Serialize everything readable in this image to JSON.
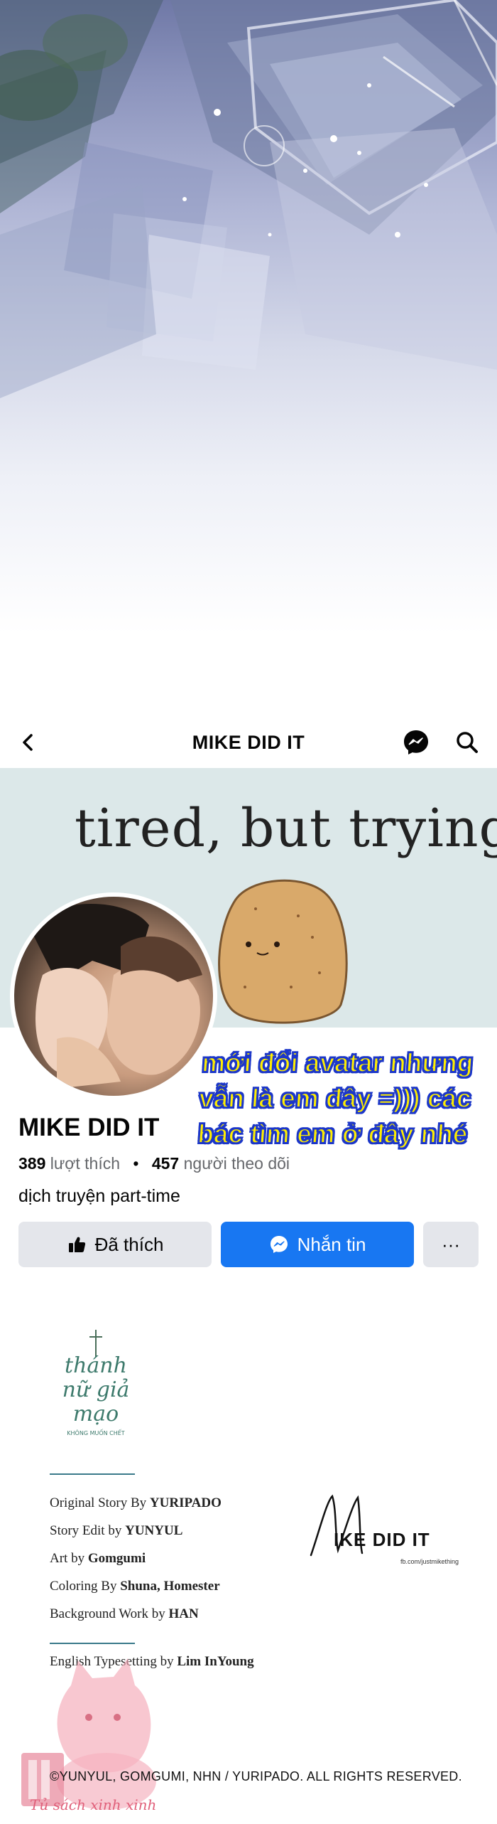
{
  "header": {
    "title": "MIKE DID IT",
    "back_icon": "chevron-left-icon",
    "messenger_icon": "messenger-icon",
    "search_icon": "search-icon"
  },
  "cover": {
    "text": "tired, but trying"
  },
  "caption": {
    "lines": [
      "mới đổi avatar nhưng",
      "vẫn là em đây =))) các",
      "bác tìm em ở đây nhé"
    ]
  },
  "page": {
    "name": "MIKE DID IT",
    "likes_count": "389",
    "likes_label": "lượt thích",
    "separator": "•",
    "followers_count": "457",
    "followers_label": "người theo dõi",
    "bio": "dịch truyện part-time"
  },
  "buttons": {
    "like": "Đã thích",
    "message": "Nhắn tin",
    "more": "···"
  },
  "logo": {
    "line1": "thánh",
    "line2": "nữ giả",
    "line3": "mạo",
    "sub": "KHÔNG MUỐN CHẾT"
  },
  "credits": [
    {
      "label": "Original Story By",
      "value": "YURIPADO"
    },
    {
      "label": "Story Edit by",
      "value": "YUNYUL"
    },
    {
      "label": "Art by",
      "value": "Gomgumi"
    },
    {
      "label": "Coloring By",
      "value": "Shuna, Homester"
    },
    {
      "label": "Background Work by",
      "value": "HAN"
    }
  ],
  "typesetting": {
    "label": "English Typesetting by",
    "value": "Lim InYoung"
  },
  "signature": {
    "text": "IKE DID IT",
    "sub": "fb.com/justmikething"
  },
  "copyright": "©YUNYUL, GOMGUMI, NHN / YURIPADO. ALL RIGHTS RESERVED.",
  "watermark": "Tủ sách xinh xinh",
  "colors": {
    "fb_blue": "#1877f2",
    "button_gray": "#e4e6eb",
    "caption_yellow": "#ffee00",
    "caption_outline": "#1c37c9"
  }
}
